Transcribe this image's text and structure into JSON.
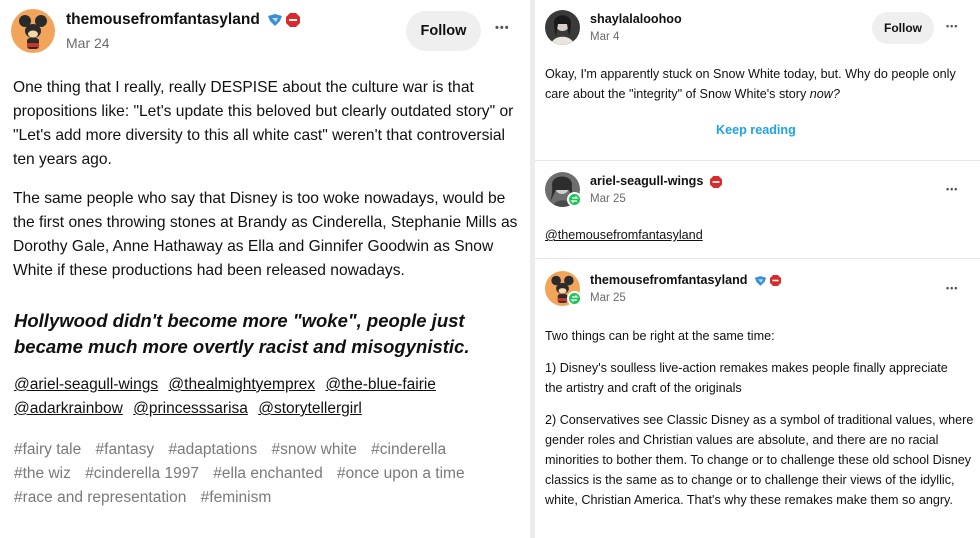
{
  "left_post": {
    "blog_name": "themousefromfantasyland",
    "date": "Mar 24",
    "follow_label": "Follow",
    "more_label": "•••",
    "paragraphs": [
      "One thing that I really, really DESPISE about the culture war is that propositions like: \"Let's update this beloved but clearly outdated story\" or \"Let's add more diversity to this all white cast\" weren't that controversial ten years ago.",
      "The same people who say that Disney is too woke nowadays, would be the first ones throwing stones at Brandy as Cinderella, Stephanie Mills as Dorothy Gale, Anne Hathaway as Ella and Ginnifer Goodwin as Snow White if these productions had been released nowadays."
    ],
    "quote": "Hollywood didn't become more \"woke\", people just became much more overtly racist and misogynistic.",
    "mentions": [
      "@ariel-seagull-wings",
      "@thealmightyemprex",
      "@the-blue-fairie",
      "@adarkrainbow",
      "@princesssarisa",
      "@storytellergirl"
    ],
    "tags": [
      "#fairy tale",
      "#fantasy",
      "#adaptations",
      "#snow white",
      "#cinderella",
      "#the wiz",
      "#cinderella 1997",
      "#ella enchanted",
      "#once upon a time",
      "#race and representation",
      "#feminism"
    ]
  },
  "right_post": {
    "blog_name": "shaylalaloohoo",
    "date": "Mar 4",
    "follow_label": "Follow",
    "more_label": "•••",
    "text_main": "Okay, I'm apparently stuck on Snow White today, but. Why do people only care about the \"integrity\" of Snow White's story ",
    "text_italic": "now?",
    "keep_reading": "Keep reading",
    "reblog1": {
      "blog_name": "ariel-seagull-wings",
      "date": "Mar 25",
      "more_label": "•••",
      "mention": "@themousefromfantasyland"
    },
    "reblog2": {
      "blog_name": "themousefromfantasyland",
      "date": "Mar 25",
      "more_label": "•••",
      "paragraphs": [
        "Two things can be right at the same time:",
        "1) Disney's soulless live-action remakes makes people finally appreciate the artistry and craft of the originals",
        "2) Conservatives see Classic Disney as a symbol of traditional values, where gender roles and Christian values are absolute, and there are no racial minorities to bother them. To change or to challenge these old school Disney classics is the same as to change or to challenge their views of the idyllic, white, Christian America. That's why these remakes make them so angry."
      ]
    }
  },
  "colors": {
    "accent_link": "#1fa3e6",
    "reblog_green": "#1ec458",
    "badge_red": "#d92b2b",
    "badge_blue": "#3a8fd6",
    "avatar_orange": "#f2a55a"
  }
}
